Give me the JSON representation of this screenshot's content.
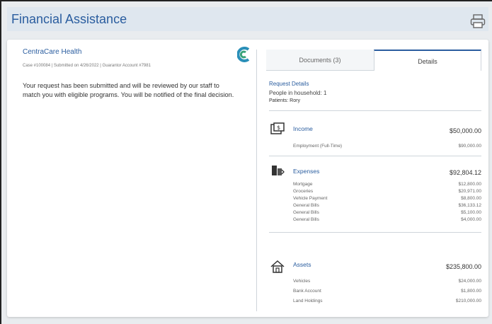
{
  "header": {
    "title": "Financial Assistance",
    "print_icon": "printer-icon"
  },
  "provider": {
    "name": "CentraCare Health",
    "case_line": "Case #100084 | Submitted on 4/26/2022 | Guarantor Account #7981",
    "message": "Your request has been submitted and will be reviewed by our staff to match you with eligible programs. You will be notified of the final decision.",
    "logo_icon": "centracare-logo-icon"
  },
  "tabs": [
    {
      "label": "Documents (3)"
    },
    {
      "label": "Details"
    }
  ],
  "request": {
    "title": "Request Details",
    "household": "People in household: 1",
    "patients": "Patients: Rory"
  },
  "income": {
    "label": "Income",
    "total": "$50,000.00",
    "icon": "income-icon",
    "rows": [
      {
        "label": "Employment (Full-Time)",
        "value": "$90,000.00"
      }
    ]
  },
  "expenses": {
    "label": "Expenses",
    "total": "$92,804.12",
    "icon": "expenses-icon",
    "rows": [
      {
        "label": "Mortgage",
        "value": "$12,800.00"
      },
      {
        "label": "Groceries",
        "value": "$20,971.00"
      },
      {
        "label": "Vehicle Payment",
        "value": "$8,800.00"
      },
      {
        "label": "General Bills",
        "value": "$36,133.12"
      },
      {
        "label": "General Bills",
        "value": "$5,100.00"
      },
      {
        "label": "General Bills",
        "value": "$4,000.00"
      }
    ]
  },
  "assets": {
    "label": "Assets",
    "total": "$235,800.00",
    "icon": "house-icon",
    "rows": [
      {
        "label": "Vehicles",
        "value": "$24,000.00"
      },
      {
        "label": "Bank Account",
        "value": "$1,800.00"
      },
      {
        "label": "Land Holdings",
        "value": "$210,000.00"
      }
    ]
  },
  "colors": {
    "accent": "#2a5d9f",
    "background": "#e9ecef",
    "card": "#ffffff"
  }
}
